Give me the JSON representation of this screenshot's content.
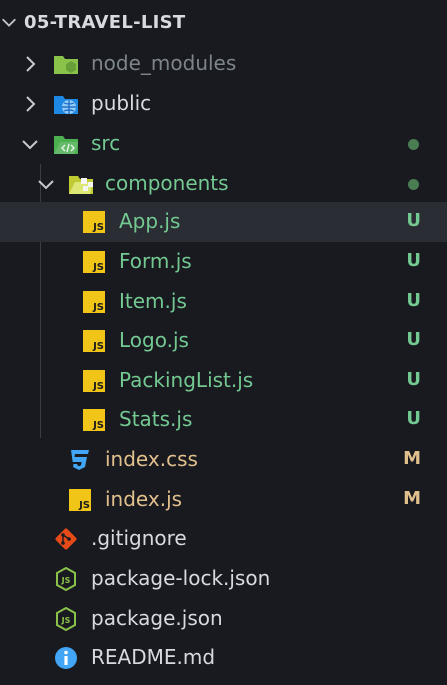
{
  "header": {
    "title": "05-TRAVEL-LIST"
  },
  "colors": {
    "background": "#181a1f",
    "selected_row": "#2a2d33",
    "untracked": "#73c991",
    "modified": "#e2c08d",
    "ignored": "#7e848c",
    "js_icon": "#f0c518",
    "css_icon": "#42a5f5",
    "git_icon": "#e64a19",
    "info_icon": "#42a5f5",
    "status_dot": "#4b7d52"
  },
  "tree": [
    {
      "label": "node_modules",
      "kind": "folder",
      "expanded": false,
      "icon": "node-folder-icon"
    },
    {
      "label": "public",
      "kind": "folder",
      "expanded": false,
      "icon": "public-folder-icon"
    },
    {
      "label": "src",
      "kind": "folder",
      "expanded": true,
      "icon": "src-folder-icon"
    },
    {
      "label": "components",
      "kind": "folder",
      "expanded": true,
      "icon": "components-folder-icon"
    },
    {
      "label": "App.js",
      "kind": "file",
      "icon": "js-icon",
      "status": "U",
      "selected": true
    },
    {
      "label": "Form.js",
      "kind": "file",
      "icon": "js-icon",
      "status": "U"
    },
    {
      "label": "Item.js",
      "kind": "file",
      "icon": "js-icon",
      "status": "U"
    },
    {
      "label": "Logo.js",
      "kind": "file",
      "icon": "js-icon",
      "status": "U"
    },
    {
      "label": "PackingList.js",
      "kind": "file",
      "icon": "js-icon",
      "status": "U"
    },
    {
      "label": "Stats.js",
      "kind": "file",
      "icon": "js-icon",
      "status": "U"
    },
    {
      "label": "index.css",
      "kind": "file",
      "icon": "css-icon",
      "status": "M"
    },
    {
      "label": "index.js",
      "kind": "file",
      "icon": "js-icon",
      "status": "M"
    },
    {
      "label": ".gitignore",
      "kind": "file",
      "icon": "git-icon"
    },
    {
      "label": "package-lock.json",
      "kind": "file",
      "icon": "json-icon"
    },
    {
      "label": "package.json",
      "kind": "file",
      "icon": "json-icon"
    },
    {
      "label": "README.md",
      "kind": "file",
      "icon": "info-icon"
    }
  ]
}
